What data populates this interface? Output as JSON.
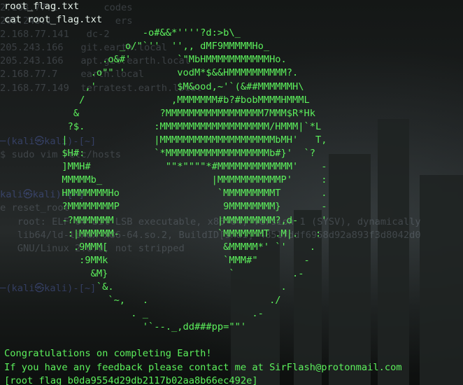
{
  "commands": [
    "root_flag.txt",
    "cat root_flag.txt"
  ],
  "ascii_art": [
    "                        -o#&&*''''?d:>b\\_",
    "                    _o/\"`''  '',, dMF9MMMMMHo_",
    "                 .o&#'        `\"MbHMMMMMMMMMMMHo.",
    "               .o\"\" '         vodM*$&&HMMMMMMMMMM?.",
    "              ,'              $M&ood,~'`(&##MMMMMMH\\",
    "             /               ,MMMMMMM#b?#bobMMMMHMMML",
    "            &              ?MMMMMMMMMMMMMMMMM7MMM$R*Hk",
    "           ?$.            :MMMMMMMMMMMMMMMMMMM/HMMM|`*L",
    "          |               |MMMMMMMMMMMMMMMMMMMMbMH'   T,",
    "          $H#:            `*MMMMMMMMMMMMMMMMMMb#}'  `?",
    "          ]MMH#             \"\"*\"\"\"\"*#MMMMMMMMMMMMM'    -",
    "          MMMMMb_                   |MMMMMMMMMMMP'     :",
    "          HMMMMMMMHo                 `MMMMMMMMMT       .",
    "          ?MMMMMMMMP                  9MMMMMMMM}       -",
    "          -?MMMMMMM                  |MMMMMMMMM?,d-    '",
    "           :|MMMMMM-                 `MMMMMMMT .M|.   :",
    "            .9MMM[                    &MMMMM*' `'    .",
    "             :9MMk                    `MMM#\"        -",
    "               &M}                     `          .-",
    "                `&.                             .",
    "                  `~,   .                     ./",
    "                      . _                  .-",
    "                        '`--._,dd###pp=\"\"'"
  ],
  "messages": [
    "Congratulations on completing Earth!",
    "If you have any feedback please contact me at SirFlash@protonmail.com",
    "[root_flag_b0da9554d29db2117b02aa8b66ec492e]"
  ],
  "ghost_lines": [
    "2.168.77.1        codes",
    "205.243.1           ers",
    "2.168.77.141   dc-2",
    "205.243.166   git.earth.local",
    "205.243.166   apt.git.earth.local",
    "2.168.77.7    earth.local",
    "2.168.77.149  terratest.earth.local",
    "",
    "",
    "",
    "─(kali㉿kali)-[~]",
    "$ sudo vim /etc/hosts",
    "",
    "",
    "kali㉿kali)-[~]",
    "e reset_root",
    "   root: ELF 64-bit LSB executable, x86-64, version 1 (SYSV), dynamically",
    "   lib64/ld-linux-x86-64.so.2, BuildID[sha1]=4851fddf6958d92a893f3d8042d0",
    "   GNU/Linux 2.0.0, not stripped",
    "",
    "",
    "─(kali㉿kali)-[~]"
  ],
  "colors": {
    "background": "#0b0d0c",
    "art_green": "#5cf05c",
    "command_text": "#e6f2ea"
  }
}
